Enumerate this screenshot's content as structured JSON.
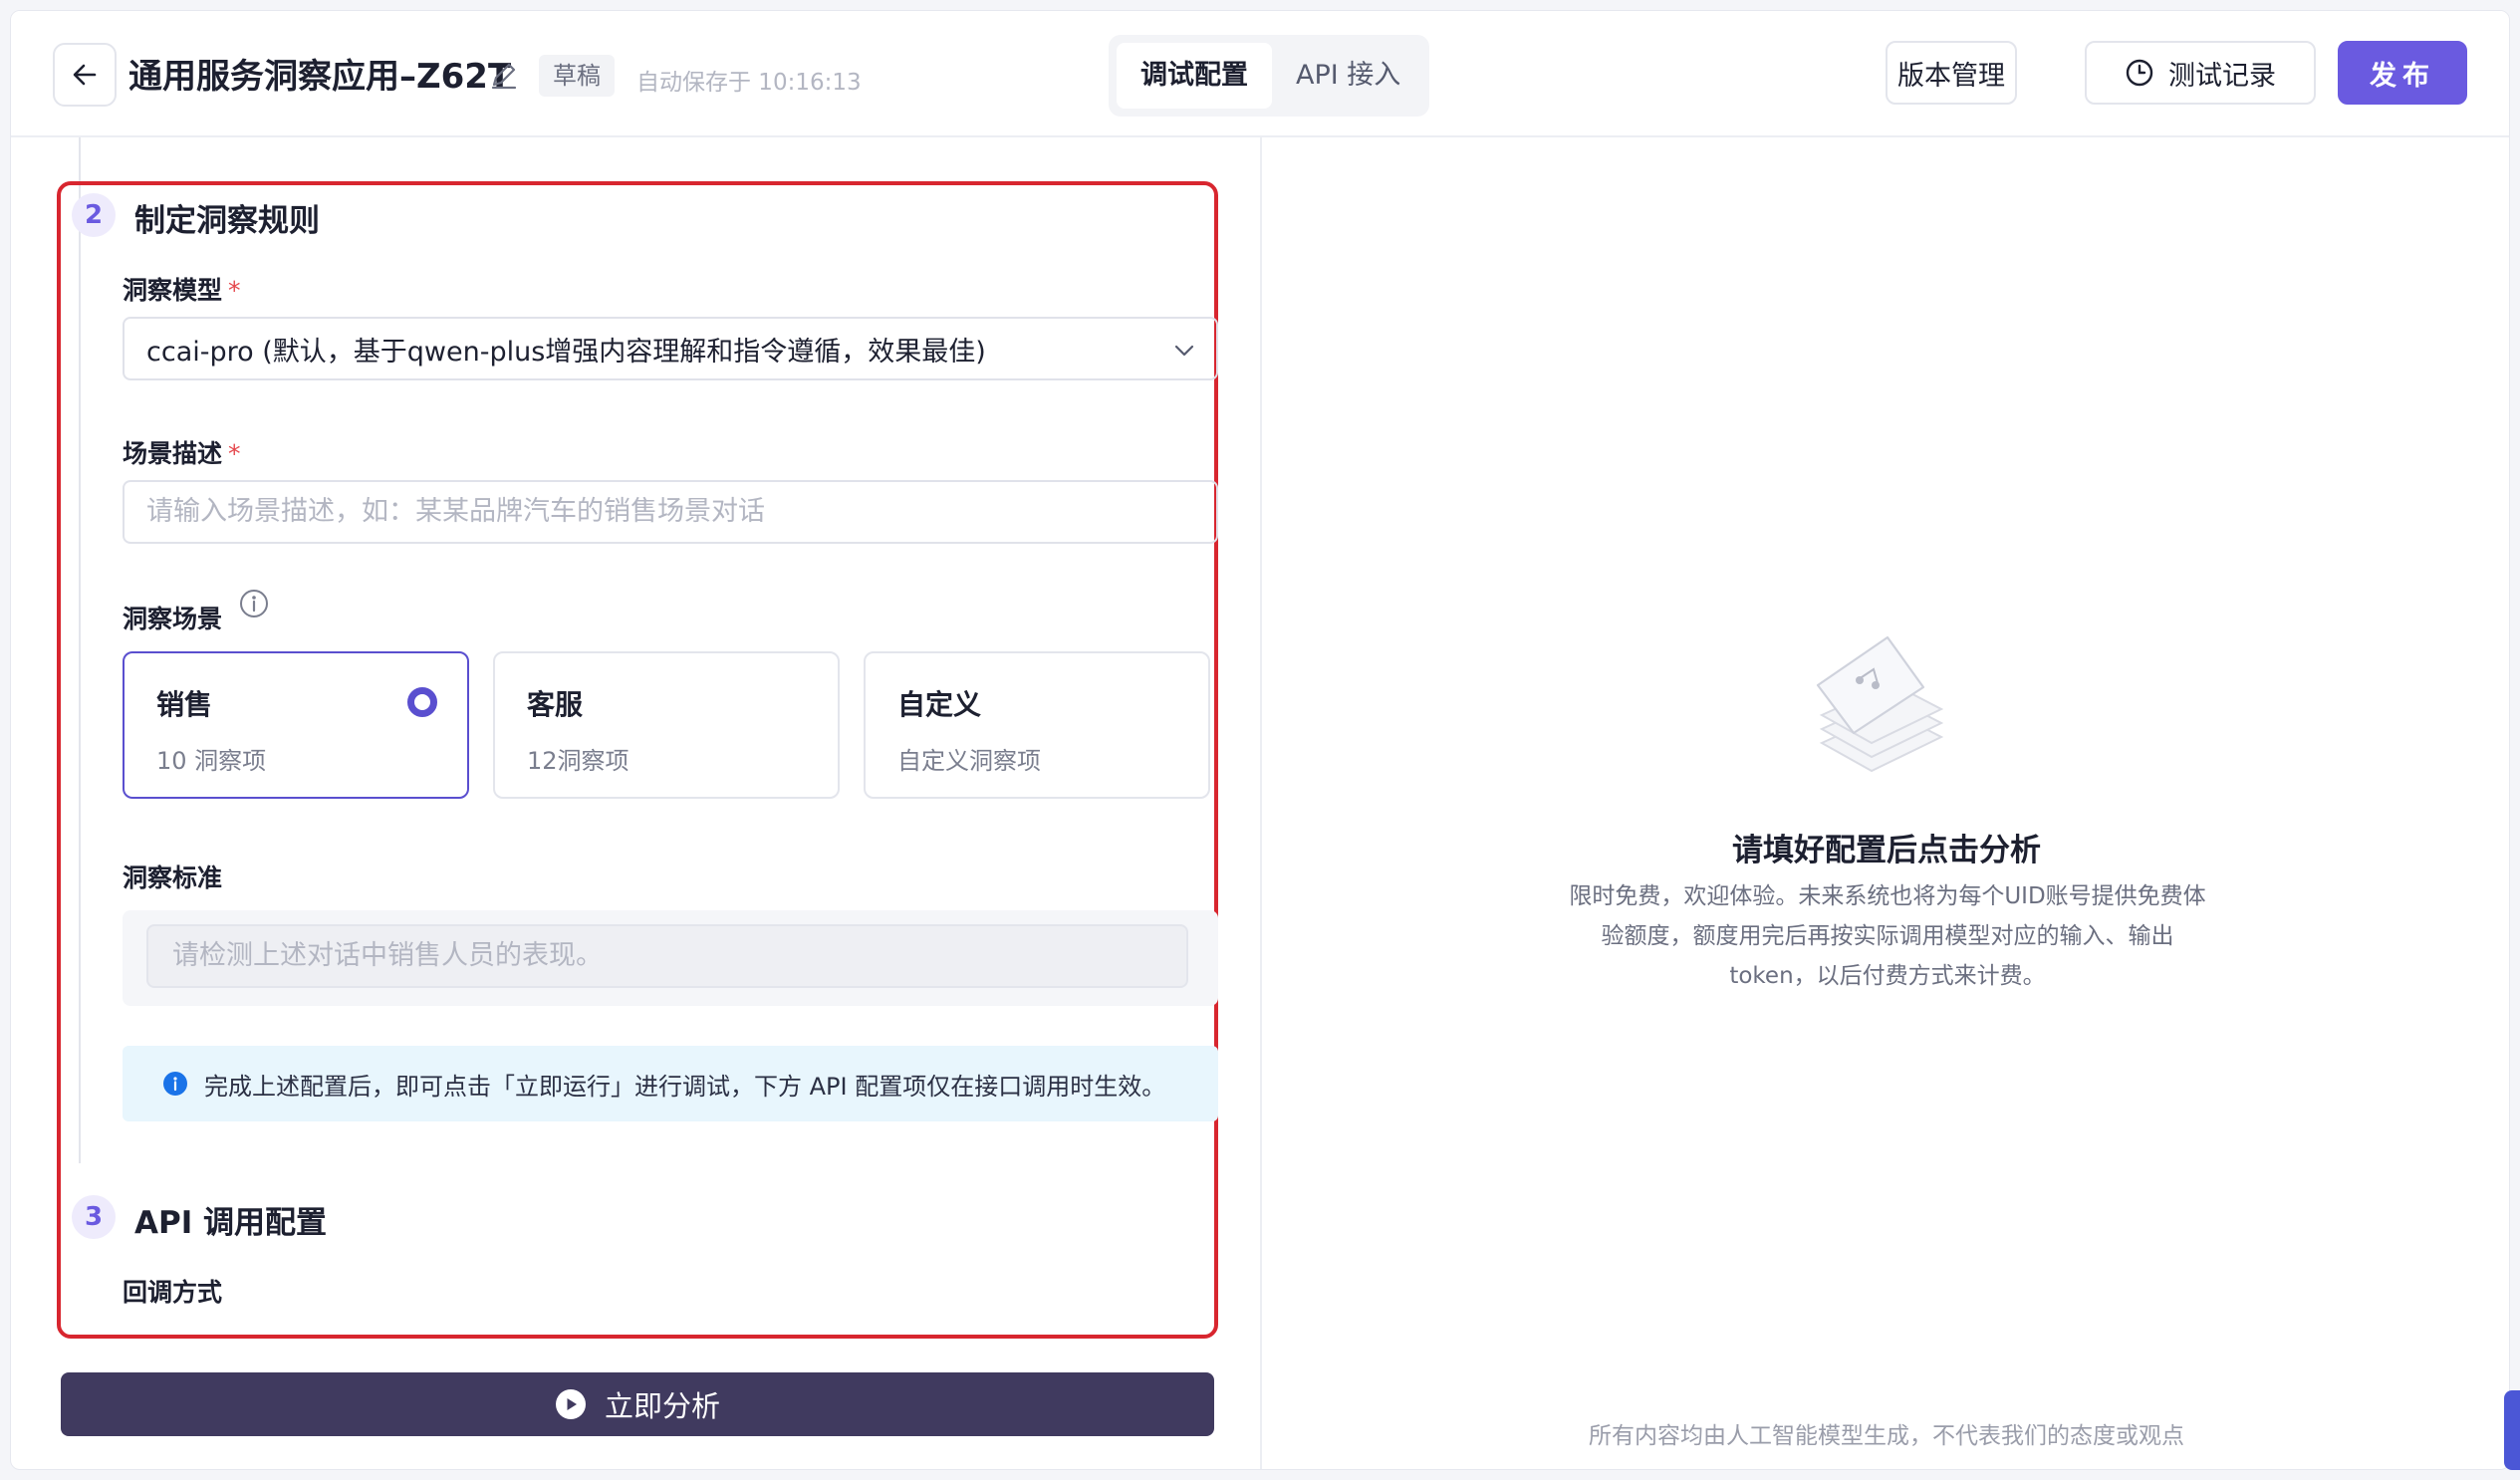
{
  "header": {
    "app_title": "通用服务洞察应用–Z62T",
    "draft_badge": "草稿",
    "autosave": "自动保存于 10:16:13",
    "tabs": [
      {
        "label": "调试配置",
        "active": true
      },
      {
        "label": "API 接入",
        "active": false
      }
    ],
    "version_button": "版本管理",
    "history_button": "测试记录",
    "publish_button": "发布",
    "accent_color": "#6a5ae0"
  },
  "section2": {
    "number": "2",
    "title": "制定洞察规则",
    "model_label": "洞察模型",
    "required_mark": "*",
    "model_value": "ccai-pro (默认，基于qwen-plus增强内容理解和指令遵循，效果最佳)",
    "scene_desc_label": "场景描述",
    "scene_desc_placeholder": "请输入场景描述，如：某某品牌汽车的销售场景对话",
    "scene_label": "洞察场景",
    "scene_cards": [
      {
        "title": "销售",
        "sub": "10 洞察项",
        "selected": true
      },
      {
        "title": "客服",
        "sub": "12洞察项",
        "selected": false
      },
      {
        "title": "自定义",
        "sub": "自定义洞察项",
        "selected": false
      }
    ],
    "standard_label": "洞察标准",
    "standard_placeholder": "请检测上述对话中销售人员的表现。",
    "notice": "完成上述配置后，即可点击「立即运行」进行调试，下方 API 配置项仅在接口调用时生效。"
  },
  "section3": {
    "number": "3",
    "title": "API 调用配置",
    "callback_label": "回调方式"
  },
  "analyze_button": "立即分析",
  "right_panel": {
    "empty_title": "请填好配置后点击分析",
    "empty_desc": "限时免费，欢迎体验。未来系统也将为每个UID账号提供免费体验额度，额度用完后再按实际调用模型对应的输入、输出token，以后付费方式来计费。",
    "footer_note": "所有内容均由人工智能模型生成，不代表我们的态度或观点"
  },
  "colors": {
    "highlight_border": "#d8262f",
    "analyze_button_bg": "#403a5f",
    "notice_bg": "#e8f6fd",
    "info_icon": "#1a73e8"
  }
}
